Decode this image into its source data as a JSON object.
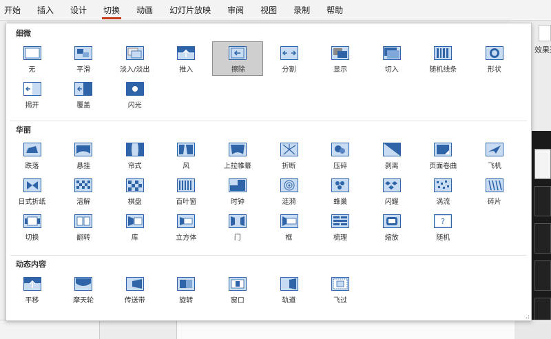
{
  "tabs": [
    {
      "label": "开始"
    },
    {
      "label": "插入"
    },
    {
      "label": "设计"
    },
    {
      "label": "切换",
      "active": true
    },
    {
      "label": "动画"
    },
    {
      "label": "幻灯片放映"
    },
    {
      "label": "审阅"
    },
    {
      "label": "视图"
    },
    {
      "label": "录制"
    },
    {
      "label": "帮助"
    }
  ],
  "ribbon_right": {
    "effect_label": "效果选"
  },
  "gallery": {
    "selected": "擦除",
    "sections": [
      {
        "title": "细微",
        "items": [
          {
            "label": "无",
            "icon": "none-transition-icon"
          },
          {
            "label": "平滑",
            "icon": "morph-transition-icon"
          },
          {
            "label": "淡入/淡出",
            "icon": "fade-transition-icon"
          },
          {
            "label": "推入",
            "icon": "push-transition-icon"
          },
          {
            "label": "擦除",
            "icon": "wipe-transition-icon"
          },
          {
            "label": "分割",
            "icon": "split-transition-icon"
          },
          {
            "label": "显示",
            "icon": "reveal-transition-icon"
          },
          {
            "label": "切入",
            "icon": "cut-transition-icon"
          },
          {
            "label": "随机线条",
            "icon": "random-bars-transition-icon"
          },
          {
            "label": "形状",
            "icon": "shape-transition-icon"
          },
          {
            "label": "揭开",
            "icon": "uncover-transition-icon"
          },
          {
            "label": "覆盖",
            "icon": "cover-transition-icon"
          },
          {
            "label": "闪光",
            "icon": "flash-transition-icon"
          }
        ]
      },
      {
        "title": "华丽",
        "items": [
          {
            "label": "跌落",
            "icon": "fall-over-transition-icon"
          },
          {
            "label": "悬挂",
            "icon": "drape-transition-icon"
          },
          {
            "label": "帘式",
            "icon": "curtains-transition-icon"
          },
          {
            "label": "风",
            "icon": "wind-transition-icon"
          },
          {
            "label": "上拉帷幕",
            "icon": "prestige-transition-icon"
          },
          {
            "label": "折断",
            "icon": "fracture-transition-icon"
          },
          {
            "label": "压碎",
            "icon": "crush-transition-icon"
          },
          {
            "label": "剥离",
            "icon": "peel-off-transition-icon"
          },
          {
            "label": "页面卷曲",
            "icon": "page-curl-transition-icon"
          },
          {
            "label": "飞机",
            "icon": "airplane-transition-icon"
          },
          {
            "label": "日式折纸",
            "icon": "origami-transition-icon"
          },
          {
            "label": "溶解",
            "icon": "dissolve-transition-icon"
          },
          {
            "label": "棋盘",
            "icon": "checkerboard-transition-icon"
          },
          {
            "label": "百叶窗",
            "icon": "blinds-transition-icon"
          },
          {
            "label": "时钟",
            "icon": "clock-transition-icon"
          },
          {
            "label": "涟漪",
            "icon": "ripple-transition-icon"
          },
          {
            "label": "蜂巢",
            "icon": "honeycomb-transition-icon"
          },
          {
            "label": "闪耀",
            "icon": "glitter-transition-icon"
          },
          {
            "label": "涡流",
            "icon": "vortex-transition-icon"
          },
          {
            "label": "碎片",
            "icon": "shred-transition-icon"
          },
          {
            "label": "切换",
            "icon": "switch-transition-icon"
          },
          {
            "label": "翻转",
            "icon": "flip-transition-icon"
          },
          {
            "label": "库",
            "icon": "gallery-transition-icon"
          },
          {
            "label": "立方体",
            "icon": "cube-transition-icon"
          },
          {
            "label": "门",
            "icon": "doors-transition-icon"
          },
          {
            "label": "框",
            "icon": "box-transition-icon"
          },
          {
            "label": "梳理",
            "icon": "comb-transition-icon"
          },
          {
            "label": "缩放",
            "icon": "zoom-transition-icon"
          },
          {
            "label": "随机",
            "icon": "random-transition-icon"
          }
        ]
      },
      {
        "title": "动态内容",
        "items": [
          {
            "label": "平移",
            "icon": "pan-transition-icon"
          },
          {
            "label": "摩天轮",
            "icon": "ferris-wheel-transition-icon"
          },
          {
            "label": "传送带",
            "icon": "conveyor-transition-icon"
          },
          {
            "label": "旋转",
            "icon": "rotate-transition-icon"
          },
          {
            "label": "窗口",
            "icon": "window-transition-icon"
          },
          {
            "label": "轨道",
            "icon": "orbit-transition-icon"
          },
          {
            "label": "飞过",
            "icon": "fly-through-transition-icon"
          }
        ]
      }
    ]
  }
}
